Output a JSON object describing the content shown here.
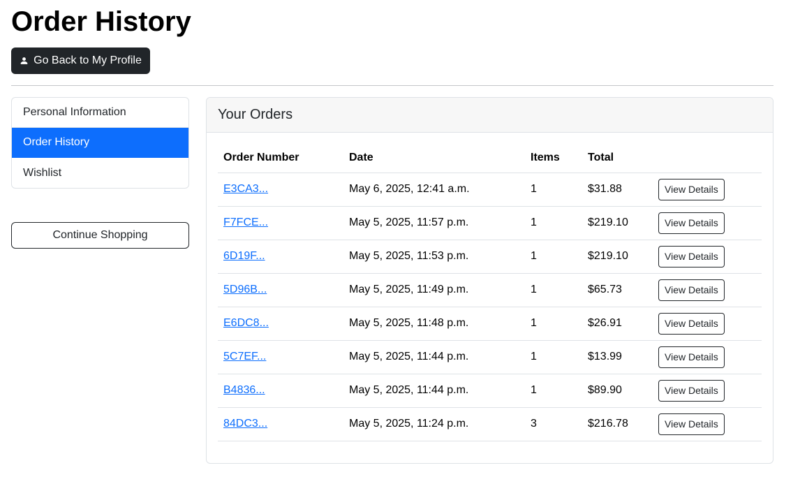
{
  "page": {
    "title": "Order History"
  },
  "back_button": {
    "label": "Go Back to My Profile",
    "icon": "person-icon"
  },
  "sidebar": {
    "items": [
      {
        "label": "Personal Information",
        "active": false
      },
      {
        "label": "Order History",
        "active": true
      },
      {
        "label": "Wishlist",
        "active": false
      }
    ],
    "continue_label": "Continue Shopping"
  },
  "orders": {
    "title": "Your Orders",
    "columns": [
      "Order Number",
      "Date",
      "Items",
      "Total",
      ""
    ],
    "view_label": "View Details",
    "rows": [
      {
        "number": "E3CA3...",
        "date": "May 6, 2025, 12:41 a.m.",
        "items": "1",
        "total": "$31.88"
      },
      {
        "number": "F7FCE...",
        "date": "May 5, 2025, 11:57 p.m.",
        "items": "1",
        "total": "$219.10"
      },
      {
        "number": "6D19F...",
        "date": "May 5, 2025, 11:53 p.m.",
        "items": "1",
        "total": "$219.10"
      },
      {
        "number": "5D96B...",
        "date": "May 5, 2025, 11:49 p.m.",
        "items": "1",
        "total": "$65.73"
      },
      {
        "number": "E6DC8...",
        "date": "May 5, 2025, 11:48 p.m.",
        "items": "1",
        "total": "$26.91"
      },
      {
        "number": "5C7EF...",
        "date": "May 5, 2025, 11:44 p.m.",
        "items": "1",
        "total": "$13.99"
      },
      {
        "number": "B4836...",
        "date": "May 5, 2025, 11:44 p.m.",
        "items": "1",
        "total": "$89.90"
      },
      {
        "number": "84DC3...",
        "date": "May 5, 2025, 11:24 p.m.",
        "items": "3",
        "total": "$216.78"
      }
    ]
  },
  "colors": {
    "primary": "#0d6efd",
    "dark": "#212529",
    "border": "#dee2e6",
    "header_bg": "#f7f7f7"
  }
}
